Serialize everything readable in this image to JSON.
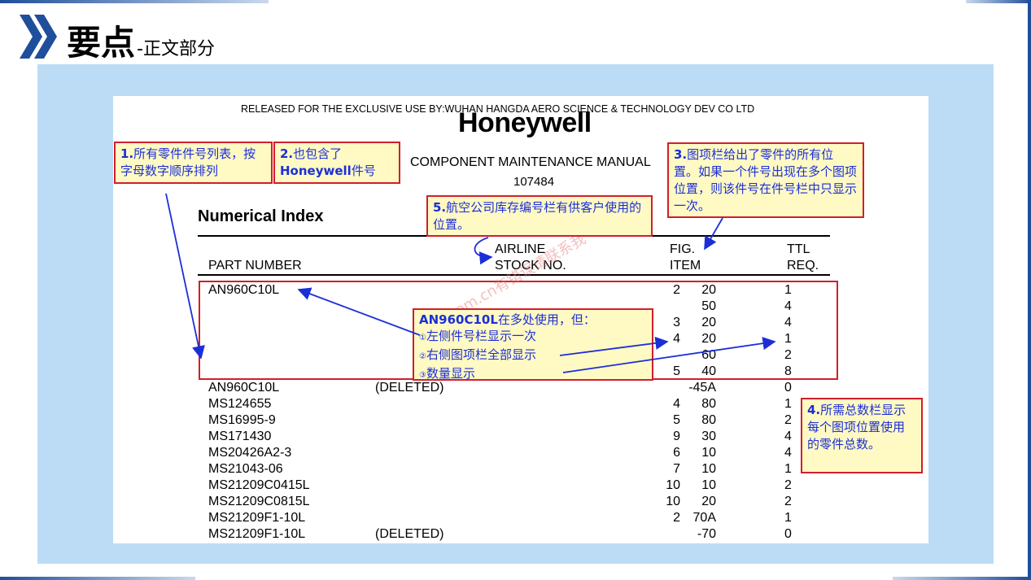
{
  "header": {
    "title_main": "要点",
    "title_sub": "-正文部分"
  },
  "document": {
    "released_line": "RELEASED FOR THE EXCLUSIVE USE BY:WUHAN HANGDA AERO SCIENCE & TECHNOLOGY DEV CO LTD",
    "logo": "Honeywell",
    "manual_title": "COMPONENT MAINTENANCE MANUAL",
    "manual_number": "107484",
    "section_title": "Numerical Index",
    "columns": {
      "part_number": "PART NUMBER",
      "airline_line1": "AIRLINE",
      "airline_line2": "STOCK NO.",
      "fig_line1": "FIG.",
      "fig_line2": "ITEM",
      "ttl_line1": "TTL",
      "ttl_line2": "REQ."
    },
    "rows": [
      {
        "part": "AN960C10L",
        "stock": "",
        "fig": "2",
        "item": "20",
        "ttl": "1"
      },
      {
        "part": "",
        "stock": "",
        "fig": "",
        "item": "50",
        "ttl": "4"
      },
      {
        "part": "",
        "stock": "",
        "fig": "3",
        "item": "20",
        "ttl": "4"
      },
      {
        "part": "",
        "stock": "",
        "fig": "4",
        "item": "20",
        "ttl": "1"
      },
      {
        "part": "",
        "stock": "",
        "fig": "",
        "item": "60",
        "ttl": "2"
      },
      {
        "part": "",
        "stock": "",
        "fig": "5",
        "item": "40",
        "ttl": "8"
      },
      {
        "part": "AN960C10L",
        "stock": "(DELETED)",
        "fig": "",
        "item": "-45A",
        "ttl": "0"
      },
      {
        "part": "MS124655",
        "stock": "",
        "fig": "4",
        "item": "80",
        "ttl": "1"
      },
      {
        "part": "MS16995-9",
        "stock": "",
        "fig": "5",
        "item": "80",
        "ttl": "2"
      },
      {
        "part": "MS171430",
        "stock": "",
        "fig": "9",
        "item": "30",
        "ttl": "4"
      },
      {
        "part": "MS20426A2-3",
        "stock": "",
        "fig": "6",
        "item": "10",
        "ttl": "4"
      },
      {
        "part": "MS21043-06",
        "stock": "",
        "fig": "7",
        "item": "10",
        "ttl": "1"
      },
      {
        "part": "MS21209C0415L",
        "stock": "",
        "fig": "10",
        "item": "10",
        "ttl": "2"
      },
      {
        "part": "MS21209C0815L",
        "stock": "",
        "fig": "10",
        "item": "20",
        "ttl": "2"
      },
      {
        "part": "MS21209F1-10L",
        "stock": "",
        "fig": "2",
        "item": "70A",
        "ttl": "1"
      },
      {
        "part": "MS21209F1-10L",
        "stock": "(DELETED)",
        "fig": "",
        "item": "-70",
        "ttl": "0"
      }
    ]
  },
  "notes": {
    "n1_num": "1.",
    "n1_text": "所有零件件号列表，按字母数字顺序排列",
    "n2_num": "2.",
    "n2_pre": "也包含了",
    "n2_bold": "Honeywell",
    "n2_post": "件号",
    "n3_num": "3.",
    "n3_text": "图项栏给出了零件的所有位置。如果一个件号出现在多个图项位置，则该件号在件号栏中只显示一次。",
    "n4_num": "4.",
    "n4_text": "所需总数栏显示每个图项位置使用的零件总数。",
    "n5_num": "5.",
    "n5_text": "航空公司库存编号栏有供客户使用的位置。",
    "center_bold": "AN960C10L",
    "center_title": "在多处使用，但：",
    "center_item1": "左侧件号栏显示一次",
    "center_item2": "右侧图项栏全部显示",
    "center_item3": "数量显示"
  },
  "watermark": "scc.com.cn有错误请联系我",
  "colors": {
    "panel": "#bcdcf6",
    "note_bg": "#fff9c4",
    "note_border": "#d01f2b",
    "note_text": "#1b2fd8",
    "accent": "#1f4e9a"
  }
}
